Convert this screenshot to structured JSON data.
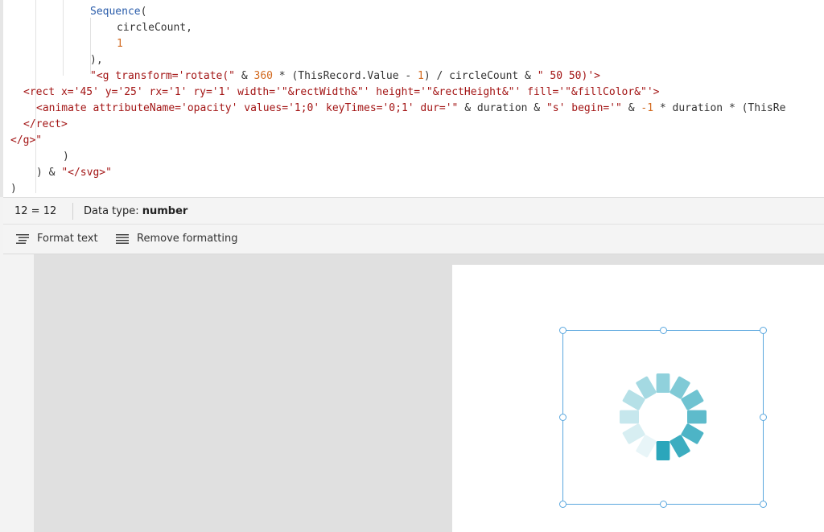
{
  "editor": {
    "lines": [
      [
        {
          "c": "fn",
          "t": "Sequence"
        },
        {
          "c": "op",
          "t": "("
        }
      ],
      [
        {
          "c": "id",
          "t": "circleCount,"
        }
      ],
      [
        {
          "c": "num",
          "t": "1"
        }
      ],
      [
        {
          "c": "op",
          "t": "),"
        }
      ],
      [
        {
          "c": "str",
          "t": "\"<g transform='rotate(\""
        },
        {
          "c": "op",
          "t": " & "
        },
        {
          "c": "num",
          "t": "360"
        },
        {
          "c": "op",
          "t": " * (ThisRecord.Value - "
        },
        {
          "c": "num",
          "t": "1"
        },
        {
          "c": "op",
          "t": ") / circleCount & "
        },
        {
          "c": "str",
          "t": "\" 50 50)'>"
        }
      ],
      [
        {
          "c": "str",
          "t": "<rect x='45' y='25' rx='1' ry='1' width='\"&rectWidth&\"' height='\"&rectHeight&\"' fill='\"&fillColor&\"'>"
        }
      ],
      [
        {
          "c": "str",
          "t": "<animate attributeName='opacity' values='1;0' keyTimes='0;1' dur='\""
        },
        {
          "c": "op",
          "t": " & duration & "
        },
        {
          "c": "str",
          "t": "\"s' begin='\""
        },
        {
          "c": "op",
          "t": " & "
        },
        {
          "c": "num",
          "t": "-1"
        },
        {
          "c": "op",
          "t": " * duration * (ThisRe"
        }
      ],
      [
        {
          "c": "str",
          "t": "</rect>"
        }
      ],
      [
        {
          "c": "str",
          "t": "</g>\""
        }
      ],
      [
        {
          "c": "op",
          "t": ")"
        }
      ],
      [
        {
          "c": "op",
          "t": ") & "
        },
        {
          "c": "str",
          "t": "\"</svg>\""
        }
      ],
      [
        {
          "c": "op",
          "t": ")"
        }
      ]
    ]
  },
  "status": {
    "result": "12  =  12",
    "type_label": "Data type: ",
    "type_value": "number"
  },
  "toolbar": {
    "format_text": "Format text",
    "remove_formatting": "Remove formatting"
  },
  "spinner": {
    "circle_count": 12,
    "color": "#2ba6bb"
  }
}
